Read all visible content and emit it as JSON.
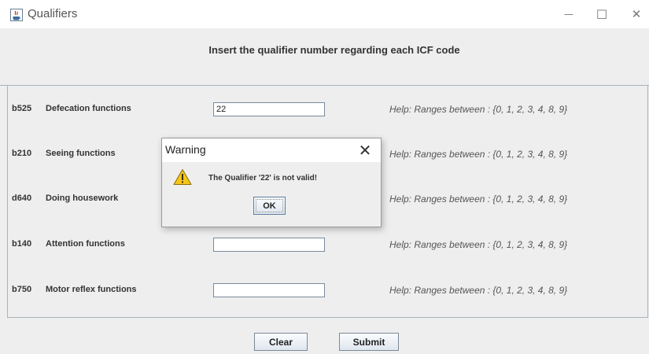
{
  "window": {
    "title": "Qualifiers",
    "app_icon": "java-icon",
    "minimize_glyph": "—",
    "maximize_glyph": "☐",
    "close_glyph": "✕"
  },
  "header": {
    "instruction": "Insert the qualifier number regarding each ICF code"
  },
  "rows": [
    {
      "code": "b525",
      "name": "Defecation functions",
      "value": "22",
      "help": "Help: Ranges between : {0, 1, 2, 3, 4, 8, 9}"
    },
    {
      "code": "b210",
      "name": "Seeing functions",
      "value": "",
      "help": "Help: Ranges between : {0, 1, 2, 3, 4, 8, 9}"
    },
    {
      "code": "d640",
      "name": "Doing housework",
      "value": "",
      "help": "Help: Ranges between : {0, 1, 2, 3, 4, 8, 9}"
    },
    {
      "code": "b140",
      "name": "Attention functions",
      "value": "",
      "help": "Help: Ranges between : {0, 1, 2, 3, 4, 8, 9}"
    },
    {
      "code": "b750",
      "name": "Motor reflex functions",
      "value": "",
      "help": "Help: Ranges between : {0, 1, 2, 3, 4, 8, 9}"
    }
  ],
  "buttons": {
    "clear": "Clear",
    "submit": "Submit"
  },
  "dialog": {
    "title": "Warning",
    "close_glyph": "✕",
    "icon": "warning-icon",
    "message": "The Qualifier '22' is not valid!",
    "ok": "OK"
  },
  "colors": {
    "background": "#eeeeee",
    "titlebar": "#ffffff",
    "border": "#a8b3bf",
    "warning_yellow": "#f5c518"
  }
}
